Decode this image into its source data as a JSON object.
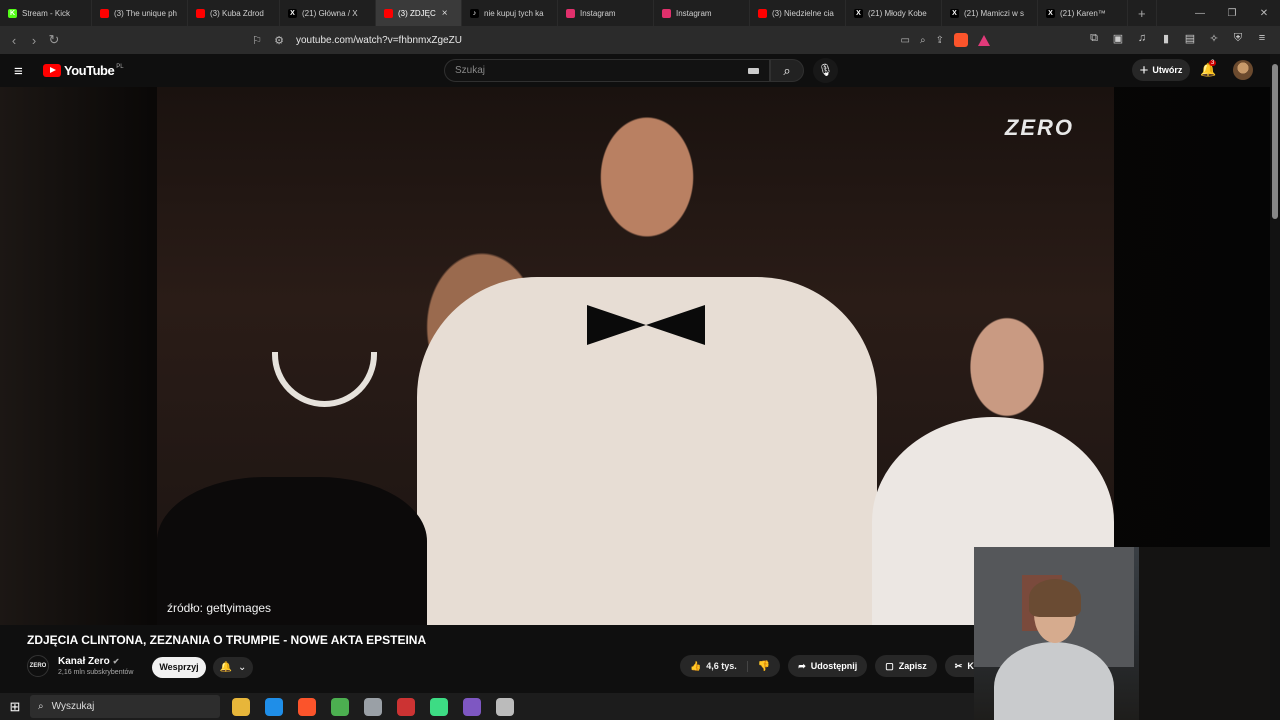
{
  "browser": {
    "tabs": [
      {
        "label": "Stream - Kick",
        "icon_color": "#53fc18",
        "icon": "K"
      },
      {
        "label": "(3) The unique ph",
        "icon_color": "#ff0000",
        "icon": ""
      },
      {
        "label": "(3) Kuba Zdrod",
        "icon_color": "#ff0000",
        "icon": ""
      },
      {
        "label": "(21) Główna / X",
        "icon_color": "#000000",
        "icon": "X"
      },
      {
        "label": "(3) ZDJĘC",
        "icon_color": "#ff0000",
        "icon": "",
        "active": true
      },
      {
        "label": "nie kupuj tych ka",
        "icon_color": "#000000",
        "icon": "♪"
      },
      {
        "label": "Instagram",
        "icon_color": "#e1306c",
        "icon": ""
      },
      {
        "label": "Instagram",
        "icon_color": "#e1306c",
        "icon": ""
      },
      {
        "label": "(3) Niedzielne cia",
        "icon_color": "#ff0000",
        "icon": ""
      },
      {
        "label": "(21) Młody Kobe",
        "icon_color": "#000000",
        "icon": "X"
      },
      {
        "label": "(21) Mamiczi w s",
        "icon_color": "#000000",
        "icon": "X"
      },
      {
        "label": "(21) Karen™",
        "icon_color": "#000000",
        "icon": "X"
      }
    ],
    "url": "youtube.com/watch?v=fhbnmxZgeZU"
  },
  "youtube": {
    "logo_text": "YouTube",
    "region": "PL",
    "search_placeholder": "Szukaj",
    "create_label": "Utwórz",
    "notification_count": "3",
    "video": {
      "watermark": "ZERO",
      "source_caption": "źródło: gettyimages",
      "title": "ZDJĘCIA CLINTONA, ZEZNANIA O TRUMPIE - NOWE AKTA EPSTEINA"
    },
    "channel": {
      "logo_text": "ZERO",
      "name": "Kanał Zero",
      "subscribers": "2,16 mln subskrybentów",
      "support_label": "Wesprzyj"
    },
    "actions": {
      "likes": "4,6 tys.",
      "share": "Udostępnij",
      "save": "Zapisz",
      "clip": "Klip"
    }
  },
  "taskbar": {
    "search_placeholder": "Wyszukaj",
    "apps": [
      "#e7b63a",
      "#1f8ee8",
      "#fb542b",
      "#4caf50",
      "#9aa0a6",
      "#cc3333",
      "#3ddc84",
      "#7e57c2",
      "#bbbbbb"
    ]
  }
}
